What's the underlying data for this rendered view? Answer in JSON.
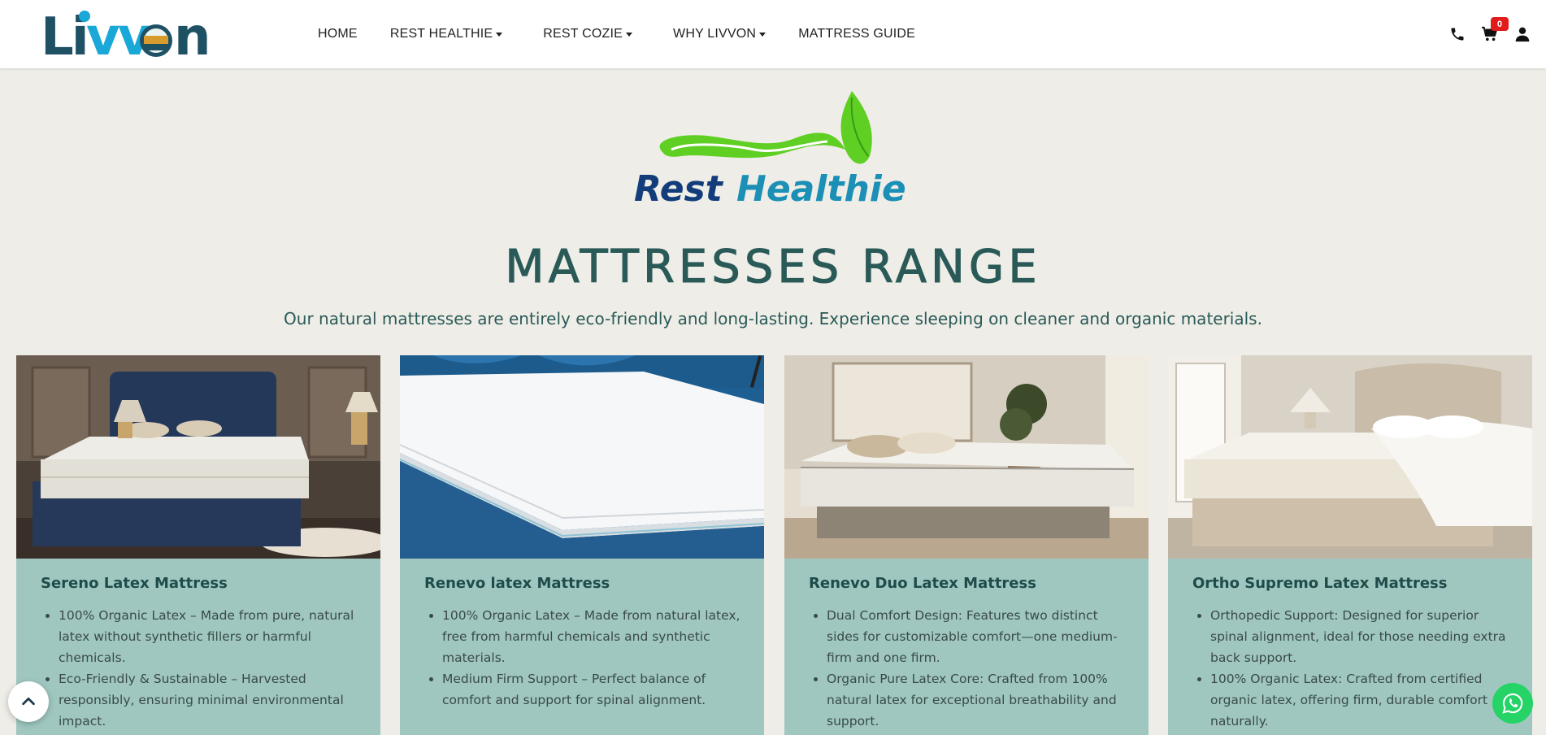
{
  "header": {
    "logo_text": "Livvon",
    "nav": [
      {
        "label": "HOME",
        "dropdown": false
      },
      {
        "label": "REST HEALTHIE",
        "dropdown": true
      },
      {
        "label": "REST COZIE",
        "dropdown": true
      },
      {
        "label": "WHY LIVVON",
        "dropdown": true
      },
      {
        "label": "MATTRESS GUIDE",
        "dropdown": false
      }
    ],
    "icons": [
      "phone-icon",
      "cart-icon",
      "user-icon"
    ],
    "cart_count": "0"
  },
  "brand": {
    "name_part1": "Rest",
    "name_part2": "Healthie"
  },
  "section": {
    "title": "MATTRESSES RANGE",
    "subtitle": "Our natural mattresses are entirely eco-friendly and long-lasting. Experience sleeping on cleaner and organic materials."
  },
  "products": [
    {
      "title": "Sereno Latex Mattress",
      "bullets": [
        "100% Organic Latex – Made from pure, natural latex without synthetic fillers or harmful chemicals.",
        "Eco-Friendly & Sustainable – Harvested responsibly, ensuring minimal environmental impact."
      ]
    },
    {
      "title": "Renevo latex Mattress",
      "bullets": [
        "100% Organic Latex – Made from natural latex, free from harmful chemicals and synthetic materials.",
        "Medium Firm Support – Perfect balance of comfort and support for spinal alignment."
      ]
    },
    {
      "title": "Renevo Duo Latex Mattress",
      "bullets": [
        "Dual Comfort Design: Features two distinct sides for customizable comfort—one medium-firm and one firm.",
        "Organic Pure Latex Core: Crafted from 100% natural latex for exceptional breathability and support."
      ]
    },
    {
      "title": "Ortho Supremo Latex Mattress",
      "bullets": [
        "Orthopedic Support: Designed for superior spinal alignment, ideal for those needing extra back support.",
        "100% Organic Latex: Crafted from certified organic latex, offering firm, durable comfort naturally."
      ]
    }
  ],
  "colors": {
    "accent_teal": "#2a5a58",
    "card_bg": "#9fc7c0",
    "page_bg": "#eeede7",
    "whatsapp": "#25d366",
    "badge": "#e21b1b"
  }
}
